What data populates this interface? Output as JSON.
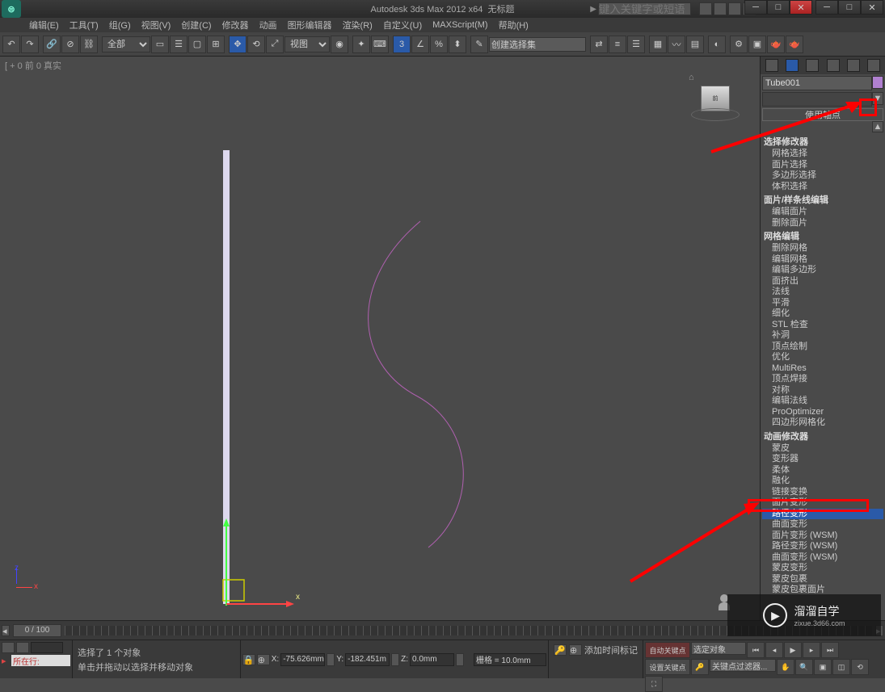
{
  "title": {
    "app": "Autodesk 3ds Max  2012 x64",
    "doc": "无标题",
    "search_ph": "键入关键字或短语"
  },
  "window_buttons": {
    "min": "─",
    "max": "□",
    "close": "✕"
  },
  "menus": [
    "编辑(E)",
    "工具(T)",
    "组(G)",
    "视图(V)",
    "创建(C)",
    "修改器",
    "动画",
    "图形编辑器",
    "渲染(R)",
    "自定义(U)",
    "MAXScript(M)",
    "帮助(H)"
  ],
  "toolbar": {
    "all_sel": "全部",
    "view_sel": "视图",
    "selset": "创建选择集"
  },
  "viewport": {
    "label": "[ + 0 前 0 真实"
  },
  "object": {
    "name": "Tube001"
  },
  "rollout_pivot": "使用轴点",
  "modifiers": {
    "hdr0": "选择修改器",
    "g0": [
      "网格选择",
      "面片选择",
      "多边形选择",
      "体积选择"
    ],
    "hdr1": "面片/样条线编辑",
    "g1": [
      "编辑面片",
      "删除面片"
    ],
    "hdr2": "网格编辑",
    "g2": [
      "删除网格",
      "编辑网格",
      "编辑多边形",
      "面挤出",
      "法线",
      "平滑",
      "细化",
      "STL 检查",
      "补洞",
      "顶点绘制",
      "优化",
      "MultiRes",
      "顶点焊接",
      "对称",
      "编辑法线",
      "ProOptimizer",
      "四边形网格化"
    ],
    "hdr3": "动画修改器",
    "g3": [
      "蒙皮",
      "变形器",
      "柔体",
      "融化",
      "链接变换",
      "面片变形",
      "路径变形",
      "曲面变形",
      "面片变形 (WSM)",
      "路径变形 (WSM)",
      "曲面变形 (WSM)",
      "蒙皮变形",
      "蒙皮包裹",
      "蒙皮包裹面片"
    ],
    "sel_index": 6
  },
  "timeline": {
    "pos": "0 / 100"
  },
  "status": {
    "prompt1": "选择了 1 个对象",
    "prompt2": "单击并拖动以选择并移动对象",
    "xl": "X:",
    "xv": "-75.626mm",
    "yl": "Y:",
    "yv": "-182.451m",
    "zl": "Z:",
    "zv": "0.0mm",
    "grid_lbl": "栅格 = 10.0mm",
    "autokey": "自动关键点",
    "setkey": "设置关键点",
    "addmark": "添加时间标记",
    "keyfilter": "关键点过滤器...",
    "selobj": "选定对象",
    "nowplay": "所在行:"
  },
  "watermark": {
    "brand": "溜溜自学",
    "url": "zixue.3d66.com"
  }
}
